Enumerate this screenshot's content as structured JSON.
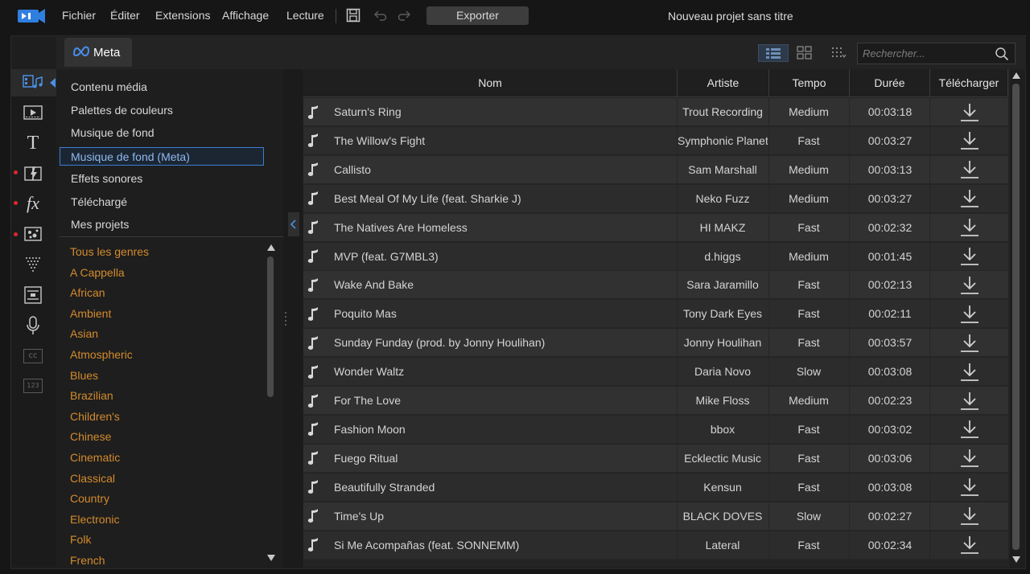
{
  "menubar": {
    "items": [
      "Fichier",
      "Éditer",
      "Extensions",
      "Affichage",
      "Lecture"
    ],
    "export_label": "Exporter",
    "project_title": "Nouveau projet sans titre"
  },
  "header": {
    "tab_label": "Meta",
    "search_placeholder": "Rechercher..."
  },
  "categories": {
    "selected_index": 3,
    "items": [
      "Contenu média",
      "Palettes de couleurs",
      "Musique de fond",
      "Musique de fond (Meta)",
      "Effets sonores",
      "Téléchargé",
      "Mes projets"
    ]
  },
  "genres": [
    "Tous les genres",
    "A Cappella",
    "African",
    "Ambient",
    "Asian",
    "Atmospheric",
    "Blues",
    "Brazilian",
    "Children's",
    "Chinese",
    "Cinematic",
    "Classical",
    "Country",
    "Electronic",
    "Folk",
    "French"
  ],
  "table": {
    "headers": {
      "name": "Nom",
      "artist": "Artiste",
      "tempo": "Tempo",
      "duration": "Durée",
      "download": "Télécharger"
    },
    "rows": [
      {
        "name": "Saturn's Ring",
        "artist": "Trout Recording",
        "tempo": "Medium",
        "duration": "00:03:18"
      },
      {
        "name": "The Willow's Fight",
        "artist": "Symphonic Planet",
        "tempo": "Fast",
        "duration": "00:03:27"
      },
      {
        "name": "Callisto",
        "artist": "Sam Marshall",
        "tempo": "Medium",
        "duration": "00:03:13"
      },
      {
        "name": "Best Meal Of My Life (feat. Sharkie J)",
        "artist": "Neko Fuzz",
        "tempo": "Medium",
        "duration": "00:03:27"
      },
      {
        "name": "The Natives Are Homeless",
        "artist": "HI MAKZ",
        "tempo": "Fast",
        "duration": "00:02:32"
      },
      {
        "name": "MVP (feat. G7MBL3)",
        "artist": "d.higgs",
        "tempo": "Medium",
        "duration": "00:01:45"
      },
      {
        "name": "Wake And Bake",
        "artist": "Sara Jaramillo",
        "tempo": "Fast",
        "duration": "00:02:13"
      },
      {
        "name": "Poquito Mas",
        "artist": "Tony Dark Eyes",
        "tempo": "Fast",
        "duration": "00:02:11"
      },
      {
        "name": "Sunday Funday (prod. by Jonny Houlihan)",
        "artist": "Jonny Houlihan",
        "tempo": "Fast",
        "duration": "00:03:57"
      },
      {
        "name": "Wonder Waltz",
        "artist": "Daria Novo",
        "tempo": "Slow",
        "duration": "00:03:08"
      },
      {
        "name": "For The Love",
        "artist": "Mike Floss",
        "tempo": "Medium",
        "duration": "00:02:23"
      },
      {
        "name": "Fashion Moon",
        "artist": "bbox",
        "tempo": "Fast",
        "duration": "00:03:02"
      },
      {
        "name": "Fuego Ritual",
        "artist": "Ecklectic Music",
        "tempo": "Fast",
        "duration": "00:03:06"
      },
      {
        "name": "Beautifully Stranded",
        "artist": "Kensun",
        "tempo": "Fast",
        "duration": "00:03:08"
      },
      {
        "name": "Time's Up",
        "artist": "BLACK DOVES",
        "tempo": "Slow",
        "duration": "00:02:27"
      },
      {
        "name": "Si Me Acompañas (feat. SONNEMM)",
        "artist": "Lateral",
        "tempo": "Fast",
        "duration": "00:02:34"
      }
    ]
  },
  "toolbar": {
    "tools": [
      "media-room-icon",
      "video-icon",
      "title-icon",
      "transition-icon",
      "effect-icon",
      "pip-icon",
      "particle-icon",
      "subtitle-layout-icon",
      "voice-record-icon",
      "captions-icon",
      "chapter-icon"
    ],
    "title_glyph": "T",
    "fx_glyph": "fx",
    "cc_glyph": "cc",
    "chapter_glyph": "123"
  },
  "colors": {
    "accent_blue": "#3b7ed4",
    "genre_orange": "#d38b2c",
    "notification_red": "#e0262f"
  }
}
